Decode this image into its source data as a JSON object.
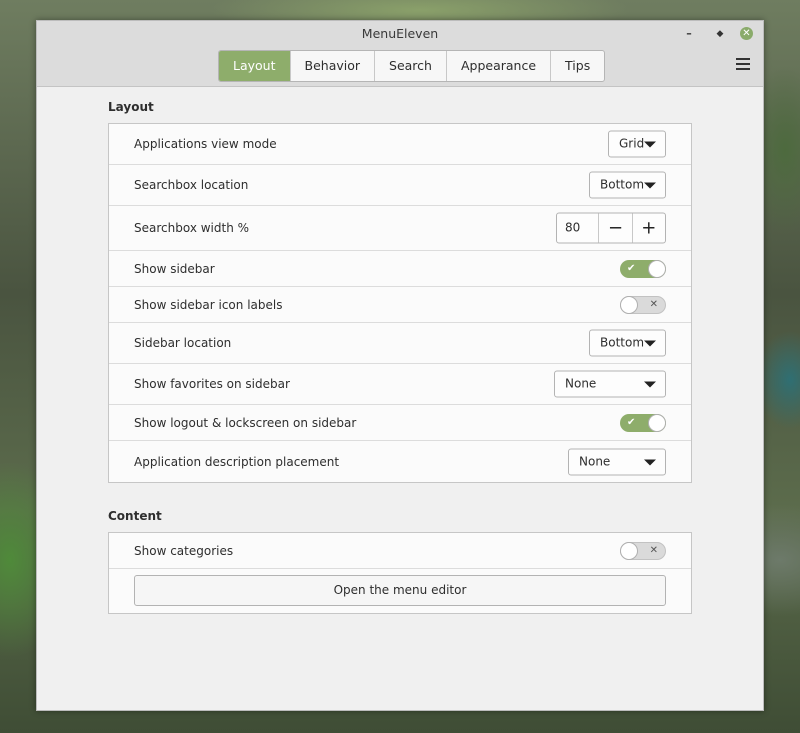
{
  "window": {
    "title": "MenuEleven"
  },
  "tabs": [
    {
      "label": "Layout",
      "active": true
    },
    {
      "label": "Behavior",
      "active": false
    },
    {
      "label": "Search",
      "active": false
    },
    {
      "label": "Appearance",
      "active": false
    },
    {
      "label": "Tips",
      "active": false
    }
  ],
  "sections": {
    "layout": {
      "title": "Layout",
      "rows": {
        "view_mode": {
          "label": "Applications view mode",
          "value": "Grid"
        },
        "searchbox_location": {
          "label": "Searchbox location",
          "value": "Bottom"
        },
        "searchbox_width": {
          "label": "Searchbox width %",
          "value": "80"
        },
        "show_sidebar": {
          "label": "Show sidebar",
          "enabled": true
        },
        "sidebar_icon_labels": {
          "label": "Show sidebar icon labels",
          "enabled": false
        },
        "sidebar_location": {
          "label": "Sidebar location",
          "value": "Bottom"
        },
        "favorites_sidebar": {
          "label": "Show favorites on sidebar",
          "value": "None"
        },
        "logout_lockscreen": {
          "label": "Show logout & lockscreen on sidebar",
          "enabled": true
        },
        "description_placement": {
          "label": "Application description placement",
          "value": "None"
        }
      }
    },
    "content": {
      "title": "Content",
      "rows": {
        "show_categories": {
          "label": "Show categories",
          "enabled": false
        },
        "menu_editor": {
          "label": "Open the menu editor"
        }
      }
    }
  },
  "colors": {
    "accent": "#8ead6b",
    "window_bg": "#f0f0f0",
    "panel_bg": "#fbfbfb"
  },
  "icons": {
    "check": "✔",
    "cross": "✕",
    "minus": "−",
    "plus": "+"
  }
}
